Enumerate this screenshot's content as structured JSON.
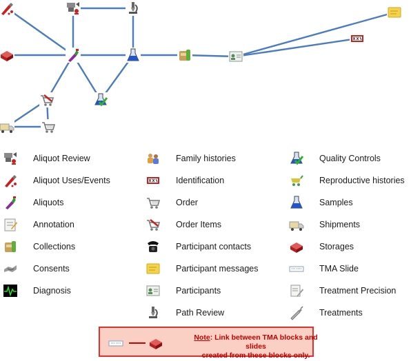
{
  "colors": {
    "edge": "#4a7cc0",
    "note_border": "#e03030",
    "note_bg": "#fbd0c4",
    "note_text": "#c00000"
  },
  "diagram": {
    "nodes": [
      {
        "id": "n_uses",
        "icon": "aliquot-uses-icon"
      },
      {
        "id": "n_review",
        "icon": "aliquot-review-icon"
      },
      {
        "id": "n_pathreview",
        "icon": "path-review-icon"
      },
      {
        "id": "n_storage",
        "icon": "storages-icon"
      },
      {
        "id": "n_aliquot",
        "icon": "aliquots-icon"
      },
      {
        "id": "n_samples",
        "icon": "samples-icon"
      },
      {
        "id": "n_collection",
        "icon": "collections-icon"
      },
      {
        "id": "n_participant",
        "icon": "participants-icon"
      },
      {
        "id": "n_message",
        "icon": "participant-messages-icon"
      },
      {
        "id": "n_ident",
        "icon": "identification-icon"
      },
      {
        "id": "n_orderitems",
        "icon": "order-items-icon"
      },
      {
        "id": "n_qc",
        "icon": "quality-controls-icon"
      },
      {
        "id": "n_shipment",
        "icon": "shipments-icon"
      },
      {
        "id": "n_order",
        "icon": "order-icon"
      }
    ],
    "edges": [
      [
        "n_uses",
        "n_aliquot"
      ],
      [
        "n_storage",
        "n_aliquot"
      ],
      [
        "n_review",
        "n_aliquot"
      ],
      [
        "n_review",
        "n_pathreview"
      ],
      [
        "n_pathreview",
        "n_samples"
      ],
      [
        "n_aliquot",
        "n_samples"
      ],
      [
        "n_aliquot",
        "n_qc"
      ],
      [
        "n_samples",
        "n_qc"
      ],
      [
        "n_samples",
        "n_collection"
      ],
      [
        "n_collection",
        "n_participant"
      ],
      [
        "n_participant",
        "n_message"
      ],
      [
        "n_participant",
        "n_ident"
      ],
      [
        "n_aliquot",
        "n_orderitems"
      ],
      [
        "n_orderitems",
        "n_shipment"
      ],
      [
        "n_orderitems",
        "n_order"
      ],
      [
        "n_shipment",
        "n_order"
      ]
    ]
  },
  "legend": {
    "col1": [
      {
        "icon": "aliquot-review-icon",
        "label": "Aliquot Review"
      },
      {
        "icon": "aliquot-uses-icon",
        "label": "Aliquot Uses/Events"
      },
      {
        "icon": "aliquots-icon",
        "label": "Aliquots"
      },
      {
        "icon": "annotation-icon",
        "label": "Annotation"
      },
      {
        "icon": "collections-icon",
        "label": "Collections"
      },
      {
        "icon": "consents-icon",
        "label": "Consents"
      },
      {
        "icon": "diagnosis-icon",
        "label": "Diagnosis"
      }
    ],
    "col2": [
      {
        "icon": "family-histories-icon",
        "label": "Family histories"
      },
      {
        "icon": "identification-icon",
        "label": "Identification"
      },
      {
        "icon": "order-icon",
        "label": "Order"
      },
      {
        "icon": "order-items-icon",
        "label": "Order Items"
      },
      {
        "icon": "participant-contacts-icon",
        "label": "Participant contacts"
      },
      {
        "icon": "participant-messages-icon",
        "label": "Participant messages"
      },
      {
        "icon": "participants-icon",
        "label": "Participants"
      },
      {
        "icon": "path-review-icon",
        "label": "Path Review"
      }
    ],
    "col3": [
      {
        "icon": "quality-controls-icon",
        "label": "Quality Controls"
      },
      {
        "icon": "reproductive-histories-icon",
        "label": "Reproductive histories"
      },
      {
        "icon": "samples-icon",
        "label": "Samples"
      },
      {
        "icon": "shipments-icon",
        "label": "Shipments"
      },
      {
        "icon": "storages-icon",
        "label": "Storages"
      },
      {
        "icon": "tma-slide-icon",
        "label": "TMA Slide"
      },
      {
        "icon": "treatment-precision-icon",
        "label": "Treatment Precision"
      },
      {
        "icon": "treatments-icon",
        "label": "Treatments"
      }
    ]
  },
  "note": {
    "keyword": "Note",
    "line1_rest": ": Link between TMA blocks and slides",
    "line2": "created from these blocks only.",
    "icons": [
      "tma-slide-icon",
      "storages-icon"
    ]
  }
}
